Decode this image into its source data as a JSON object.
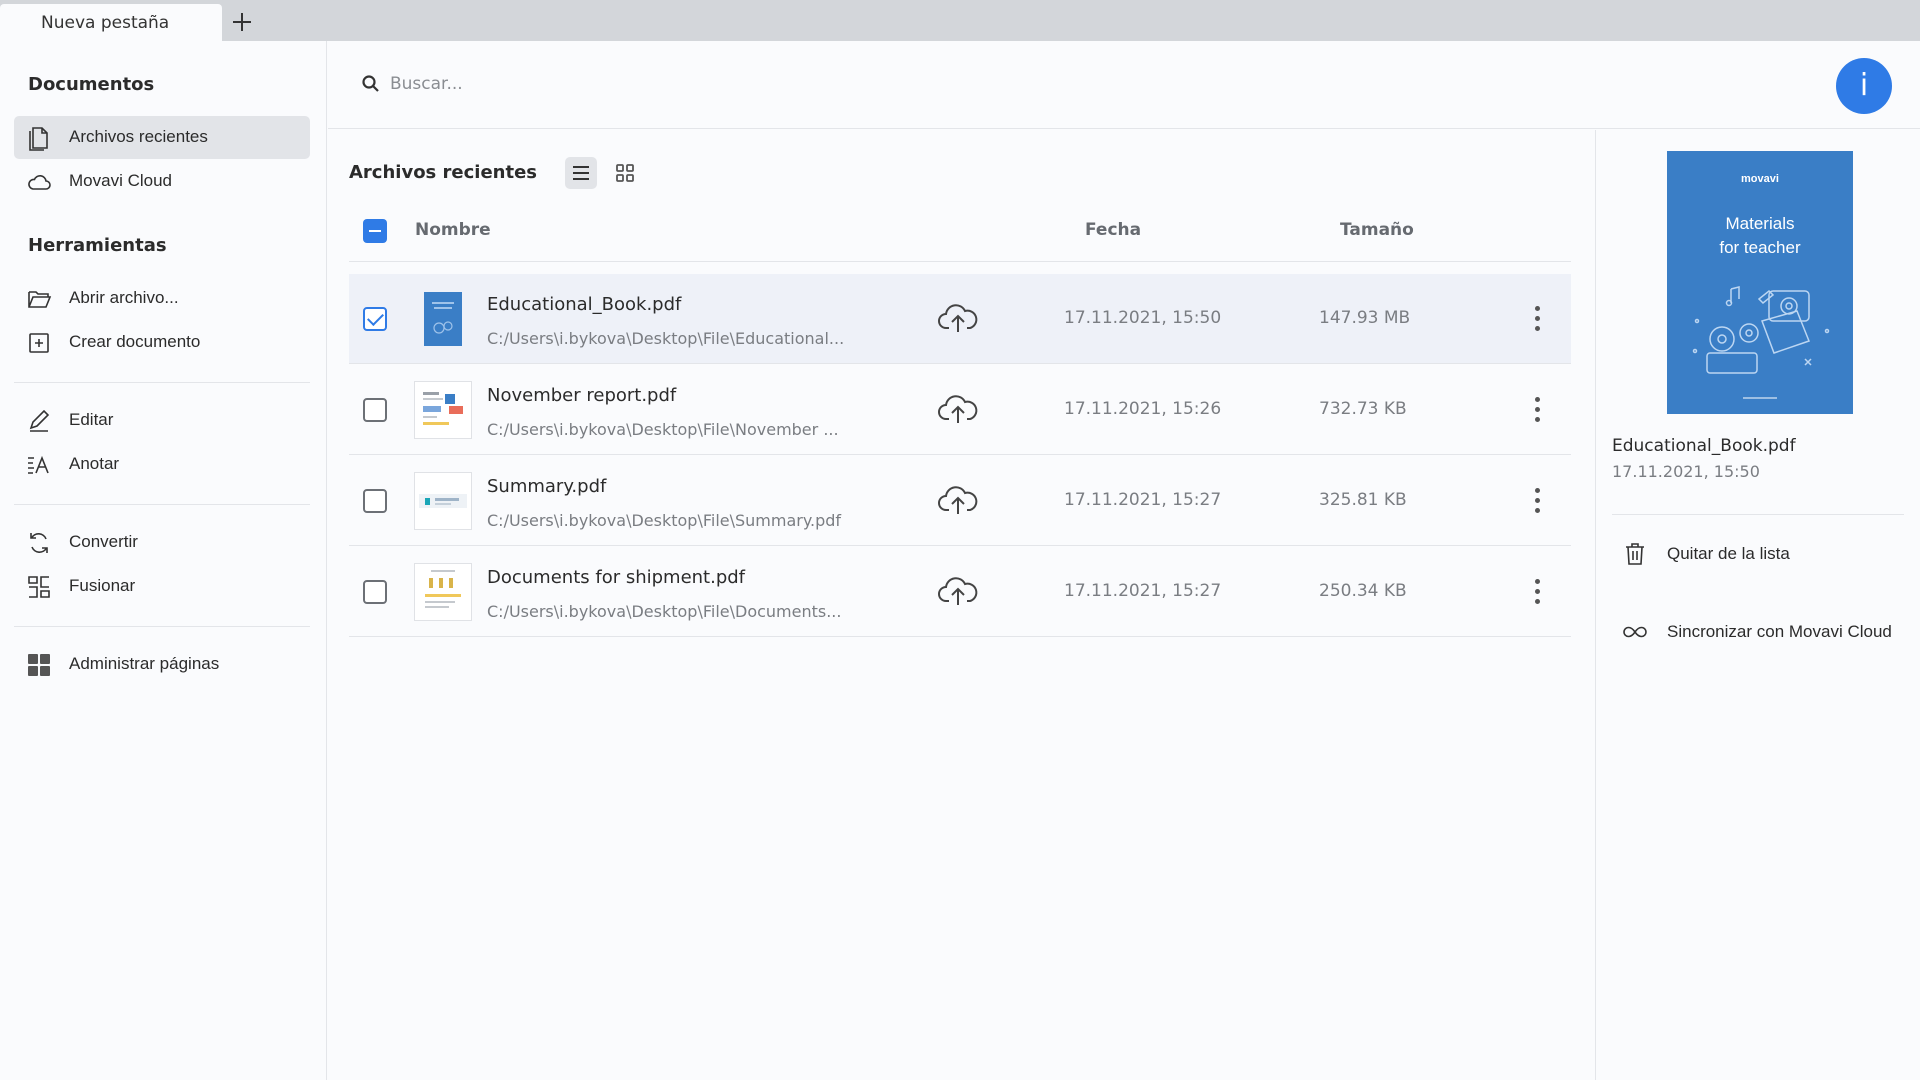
{
  "tabs": [
    {
      "label": "Nueva pestaña"
    }
  ],
  "sidebar": {
    "documents_heading": "Documentos",
    "documents": [
      {
        "label": "Archivos recientes",
        "icon": "recent-files-icon",
        "active": true
      },
      {
        "label": "Movavi Cloud",
        "icon": "cloud-icon"
      }
    ],
    "tools_heading": "Herramientas",
    "tools": [
      {
        "label": "Abrir archivo...",
        "icon": "folder-open-icon"
      },
      {
        "label": "Crear documento",
        "icon": "create-document-icon"
      },
      {
        "label": "Editar",
        "icon": "pencil-icon"
      },
      {
        "label": "Anotar",
        "icon": "annotate-icon"
      },
      {
        "label": "Convertir",
        "icon": "convert-icon"
      },
      {
        "label": "Fusionar",
        "icon": "merge-icon"
      },
      {
        "label": "Administrar páginas",
        "icon": "pages-grid-icon"
      }
    ]
  },
  "search": {
    "placeholder": "Buscar...",
    "value": ""
  },
  "info_button": {
    "label": "i"
  },
  "main": {
    "title": "Archivos recientes",
    "columns": {
      "name": "Nombre",
      "date": "Fecha",
      "size": "Tamaño"
    },
    "files": [
      {
        "name": "Educational_Book.pdf",
        "path": "C:/Users\\i.bykova\\Desktop\\File\\Educational...",
        "date": "17.11.2021, 15:50",
        "size": "147.93 MB",
        "checked": true
      },
      {
        "name": "November report.pdf",
        "path": "C:/Users\\i.bykova\\Desktop\\File\\November ...",
        "date": "17.11.2021, 15:26",
        "size": "732.73 KB",
        "checked": false
      },
      {
        "name": "Summary.pdf",
        "path": "C:/Users\\i.bykova\\Desktop\\File\\Summary.pdf",
        "date": "17.11.2021, 15:27",
        "size": "325.81 KB",
        "checked": false
      },
      {
        "name": "Documents for shipment.pdf",
        "path": "C:/Users\\i.bykova\\Desktop\\File\\Documents...",
        "date": "17.11.2021, 15:27",
        "size": "250.34 KB",
        "checked": false
      }
    ]
  },
  "details": {
    "preview_logo": "movavi",
    "preview_title_line1": "Materials",
    "preview_title_line2": "for teacher",
    "name": "Educational_Book.pdf",
    "date": "17.11.2021, 15:50",
    "remove_label": "Quitar de la lista",
    "sync_label": "Sincronizar con Movavi Cloud"
  },
  "colors": {
    "accent": "#2f7be6",
    "preview_bg": "#3a7ec6"
  }
}
